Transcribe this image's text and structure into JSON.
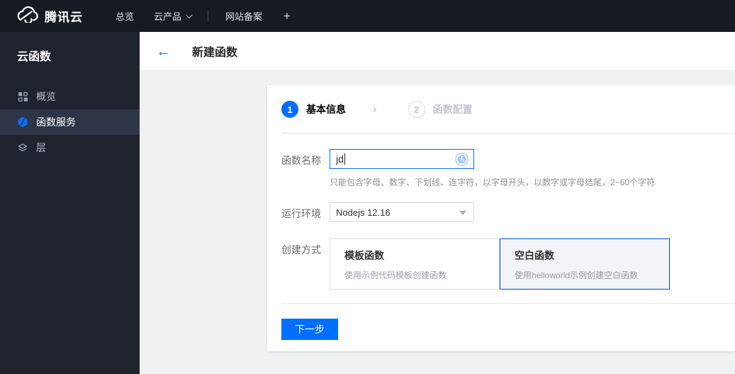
{
  "navbar": {
    "brand": "腾讯云",
    "items": [
      {
        "label": "总览"
      },
      {
        "label": "云产品"
      },
      {
        "label": "网站备案"
      },
      {
        "label": "+"
      }
    ]
  },
  "sidebar": {
    "title": "云函数",
    "items": [
      {
        "label": "概览",
        "icon": "grid-icon",
        "active": false
      },
      {
        "label": "函数服务",
        "icon": "function-service-icon",
        "active": true
      },
      {
        "label": "层",
        "icon": "layers-icon",
        "active": false
      }
    ]
  },
  "header": {
    "back_icon": "←",
    "title": "新建函数"
  },
  "wizard": {
    "chevron_icon": "›",
    "steps": [
      {
        "num": "1",
        "label": "基本信息",
        "state": "current"
      },
      {
        "num": "2",
        "label": "函数配置",
        "state": "pending"
      }
    ]
  },
  "form": {
    "name": {
      "label": "函数名称",
      "value": "jd",
      "help": "只能包含字母、数字、下划线、连字符，以字母开头，以数字或字母结尾，2~60个字符",
      "status_icon": "pending-clock-icon"
    },
    "runtime": {
      "label": "运行环境",
      "value": "Nodejs 12.16"
    },
    "method": {
      "label": "创建方式",
      "options": [
        {
          "title": "模板函数",
          "desc": "使用示例代码模板创建函数",
          "selected": false
        },
        {
          "title": "空白函数",
          "desc": "使用helloworld示例创建空白函数",
          "selected": true
        }
      ]
    }
  },
  "footer": {
    "next_label": "下一步"
  },
  "colors": {
    "accent_blue": "#006eff",
    "selected_border": "#0052d9",
    "navbar_bg": "#161a23",
    "sidebar_bg": "#1e232e",
    "sidebar_active_bg": "#2d3547",
    "content_bg": "#f0f1f2",
    "helper_text": "#8a8e94"
  }
}
